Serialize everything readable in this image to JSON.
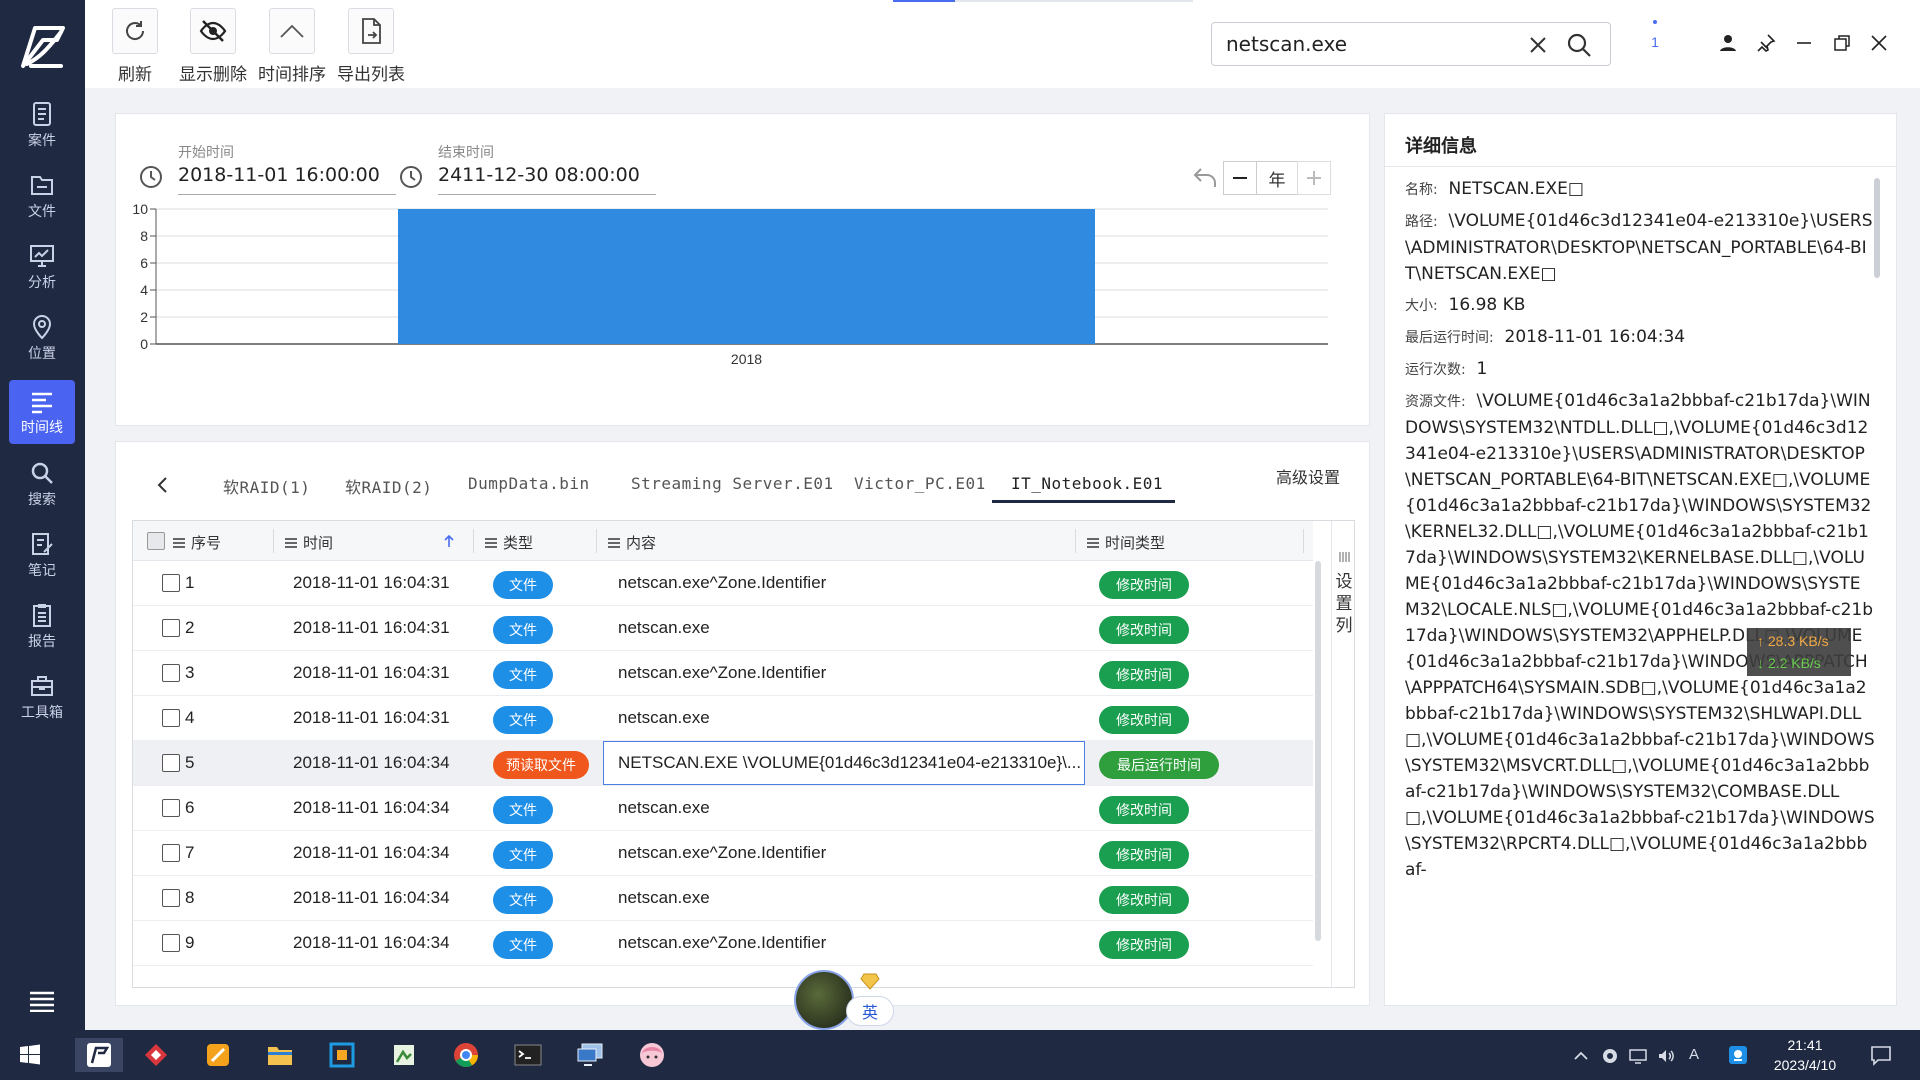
{
  "sidebar": {
    "items": [
      {
        "label": "案件",
        "icon": "case-icon"
      },
      {
        "label": "文件",
        "icon": "folder-icon"
      },
      {
        "label": "分析",
        "icon": "analysis-icon"
      },
      {
        "label": "位置",
        "icon": "location-icon"
      },
      {
        "label": "时间线",
        "icon": "timeline-icon",
        "active": true
      },
      {
        "label": "搜索",
        "icon": "search-icon"
      },
      {
        "label": "笔记",
        "icon": "note-icon"
      },
      {
        "label": "报告",
        "icon": "report-icon"
      },
      {
        "label": "工具箱",
        "icon": "toolbox-icon"
      }
    ]
  },
  "toolbar": {
    "refresh_label": "刷新",
    "show_deleted_label": "显示删除",
    "time_sort_label": "时间排序",
    "export_label": "导出列表"
  },
  "search": {
    "value": "netscan.exe"
  },
  "notification": {
    "count": "1"
  },
  "range": {
    "start_label": "开始时间",
    "start_value": "2018-11-01 16:00:00",
    "end_label": "结束时间",
    "end_value": "2411-12-30 08:00:00",
    "unit": "年"
  },
  "chart_data": {
    "type": "bar",
    "categories": [
      "2018"
    ],
    "values": [
      10
    ],
    "ylim": [
      0,
      10
    ],
    "yticks": [
      0,
      2,
      4,
      6,
      8,
      10
    ],
    "grid": true,
    "color": "#2f8ae0"
  },
  "tabs": {
    "items": [
      "软RAID(1)",
      "软RAID(2)",
      "DumpData.bin",
      "Streaming Server.E01",
      "Victor_PC.E01",
      "IT_Notebook.E01"
    ],
    "active_index": 5,
    "advanced_label": "高级设置"
  },
  "table": {
    "headers": {
      "index": "序号",
      "time": "时间",
      "type": "类型",
      "content": "内容",
      "time_type": "时间类型"
    },
    "rows": [
      {
        "num": "1",
        "time": "2018-11-01 16:04:31",
        "type": "文件",
        "content": "netscan.exe^Zone.Identifier",
        "time_type": "修改时间"
      },
      {
        "num": "2",
        "time": "2018-11-01 16:04:31",
        "type": "文件",
        "content": "netscan.exe",
        "time_type": "修改时间"
      },
      {
        "num": "3",
        "time": "2018-11-01 16:04:31",
        "type": "文件",
        "content": "netscan.exe^Zone.Identifier",
        "time_type": "修改时间"
      },
      {
        "num": "4",
        "time": "2018-11-01 16:04:31",
        "type": "文件",
        "content": "netscan.exe",
        "time_type": "修改时间"
      },
      {
        "num": "5",
        "time": "2018-11-01 16:04:34",
        "type": "预读取文件",
        "content": "NETSCAN.EXE \\VOLUME{01d46c3d12341e04-e213310e}\\...",
        "time_type": "最后运行时间"
      },
      {
        "num": "6",
        "time": "2018-11-01 16:04:34",
        "type": "文件",
        "content": "netscan.exe",
        "time_type": "修改时间"
      },
      {
        "num": "7",
        "time": "2018-11-01 16:04:34",
        "type": "文件",
        "content": "netscan.exe^Zone.Identifier",
        "time_type": "修改时间"
      },
      {
        "num": "8",
        "time": "2018-11-01 16:04:34",
        "type": "文件",
        "content": "netscan.exe",
        "time_type": "修改时间"
      },
      {
        "num": "9",
        "time": "2018-11-01 16:04:34",
        "type": "文件",
        "content": "netscan.exe^Zone.Identifier",
        "time_type": "修改时间"
      }
    ],
    "column_setting_label": "设置列"
  },
  "detail": {
    "title": "详细信息",
    "name_key": "名称:",
    "name_val": "NETSCAN.EXE□",
    "path_key": "路径:",
    "path_val": "\\VOLUME{01d46c3d12341e04-e213310e}\\USERS\\ADMINISTRATOR\\DESKTOP\\NETSCAN_PORTABLE\\64-BIT\\NETSCAN.EXE□",
    "size_key": "大小:",
    "size_val": "16.98 KB",
    "last_run_key": "最后运行时间:",
    "last_run_val": "2018-11-01 16:04:34",
    "run_count_key": "运行次数:",
    "run_count_val": "1",
    "resources_key": "资源文件:",
    "resources_val": "\\VOLUME{01d46c3a1a2bbbaf-c21b17da}\\WINDOWS\\SYSTEM32\\NTDLL.DLL□,\\VOLUME{01d46c3d12341e04-e213310e}\\USERS\\ADMINISTRATOR\\DESKTOP\\NETSCAN_PORTABLE\\64-BIT\\NETSCAN.EXE□,\\VOLUME{01d46c3a1a2bbbaf-c21b17da}\\WINDOWS\\SYSTEM32\\KERNEL32.DLL□,\\VOLUME{01d46c3a1a2bbbaf-c21b17da}\\WINDOWS\\SYSTEM32\\KERNELBASE.DLL□,\\VOLUME{01d46c3a1a2bbbaf-c21b17da}\\WINDOWS\\SYSTEM32\\LOCALE.NLS□,\\VOLUME{01d46c3a1a2bbbaf-c21b17da}\\WINDOWS\\SYSTEM32\\APPHELP.DLL□,\\VOLUME{01d46c3a1a2bbbaf-c21b17da}\\WINDOWS\\APPPATCH\\APPPATCH64\\SYSMAIN.SDB□,\\VOLUME{01d46c3a1a2bbbaf-c21b17da}\\WINDOWS\\SYSTEM32\\SHLWAPI.DLL□,\\VOLUME{01d46c3a1a2bbbaf-c21b17da}\\WINDOWS\\SYSTEM32\\MSVCRT.DLL□,\\VOLUME{01d46c3a1a2bbbaf-c21b17da}\\WINDOWS\\SYSTEM32\\COMBASE.DLL□,\\VOLUME{01d46c3a1a2bbbaf-c21b17da}\\WINDOWS\\SYSTEM32\\RPCRT4.DLL□,\\VOLUME{01d46c3a1a2bbbaf-"
  },
  "net_speed": {
    "up": "↑ 28.3 KB/s",
    "down": "↓ 2.2 KB/s"
  },
  "ime": {
    "label": "英"
  },
  "taskbar": {
    "time": "21:41",
    "date": "2023/4/10",
    "tray_lang": "A"
  },
  "colors": {
    "sidebar_bg": "#1f2942",
    "accent": "#4a63f0",
    "file_badge": "#1e8fe6",
    "prefetch_badge": "#f0571c",
    "mod_badge": "#1a9e50",
    "bar": "#2f8ae0"
  }
}
